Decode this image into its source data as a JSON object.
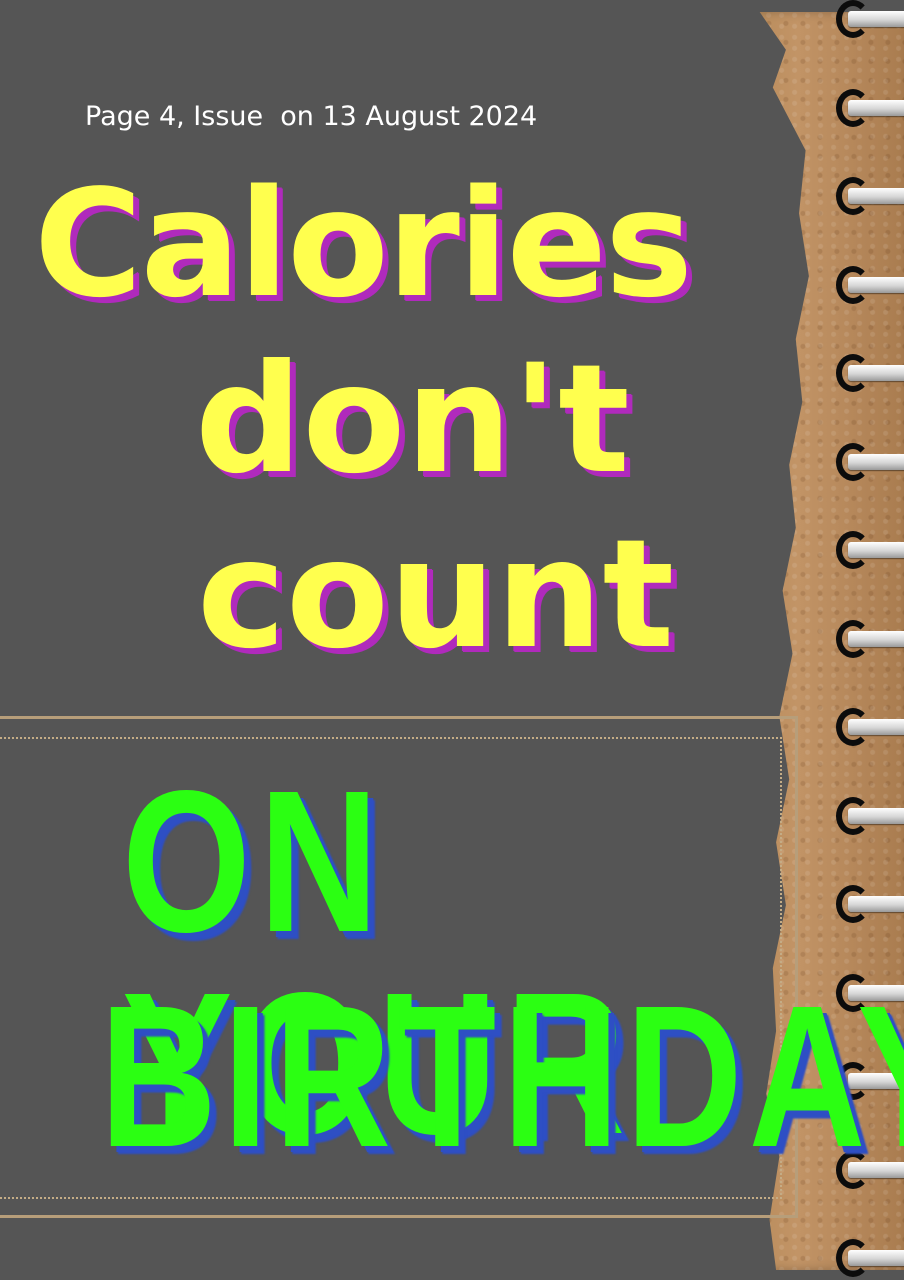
{
  "issue_line": "Page 4, Issue  on 13 August 2024",
  "headline": {
    "line1": "Calories",
    "line2": "don't",
    "line3": "count"
  },
  "subheadline": {
    "line1": "ON YOUR",
    "line2": "BIRTHDAY"
  },
  "colors": {
    "background": "#555555",
    "headline_fill": "#ffff4e",
    "headline_shadow": "#b02abc",
    "subheadline_fill": "#2bff12",
    "subheadline_shadow": "#2e4fc4",
    "paper": "#c29466",
    "frame": "#b79e7a"
  },
  "decorations": [
    "torn-kraft-paper",
    "spiral-binding"
  ]
}
